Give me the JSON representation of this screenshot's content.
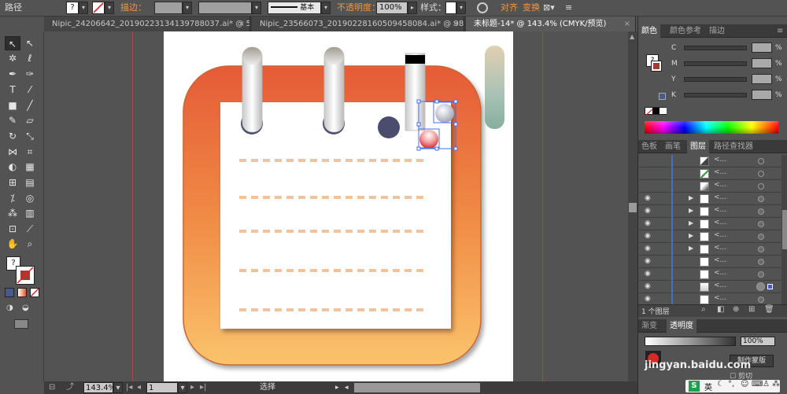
{
  "control_bar": {
    "selection_type": "路径",
    "stroke_label": "描边：",
    "stroke_profile": "基本",
    "opacity_label": "不透明度：",
    "opacity_value": "100%",
    "style_label": "样式：",
    "align_label": "对齐",
    "transform_label": "变换"
  },
  "document_tabs": [
    {
      "label": "Nipic_24206642_20190223134139788037.ai* @ 50..."
    },
    {
      "label": "Nipic_23566073_20190228160509458084.ai* @ 98..."
    },
    {
      "label": "未标题-14* @ 143.4% (CMYK/预览)"
    }
  ],
  "tab_close": "×",
  "status_bar": {
    "zoom": "143.4%",
    "page": "1",
    "tool_status": "选择"
  },
  "color_panel": {
    "tabs": [
      "颜色",
      "颜色参考",
      "描边"
    ],
    "channels": [
      {
        "label": "C",
        "unit": "%"
      },
      {
        "label": "M",
        "unit": "%"
      },
      {
        "label": "Y",
        "unit": "%"
      },
      {
        "label": "K",
        "unit": "%"
      }
    ]
  },
  "layers_panel": {
    "tabs": [
      "色板",
      "画笔",
      "图层",
      "路径查找器"
    ],
    "row_name": "<...",
    "count_label": "1 个图层"
  },
  "bottom_panel": {
    "tabs": [
      "渐变",
      "透明度"
    ],
    "opacity_value": "100%",
    "make_mask_button": "制作蒙版",
    "clip_label": "剪切"
  },
  "watermark": {
    "site": "jingyan.baidu.com"
  },
  "ime": {
    "lang": "英"
  },
  "colors": {
    "artboard": "#ffffff",
    "guide": "#a8474c",
    "icon_gradient_top": "#e55b37",
    "icon_gradient_bottom": "#fbc36b",
    "dash": "#eec39e",
    "ring_hole": "#4c4c6e",
    "selection": "#4a6cf0"
  }
}
